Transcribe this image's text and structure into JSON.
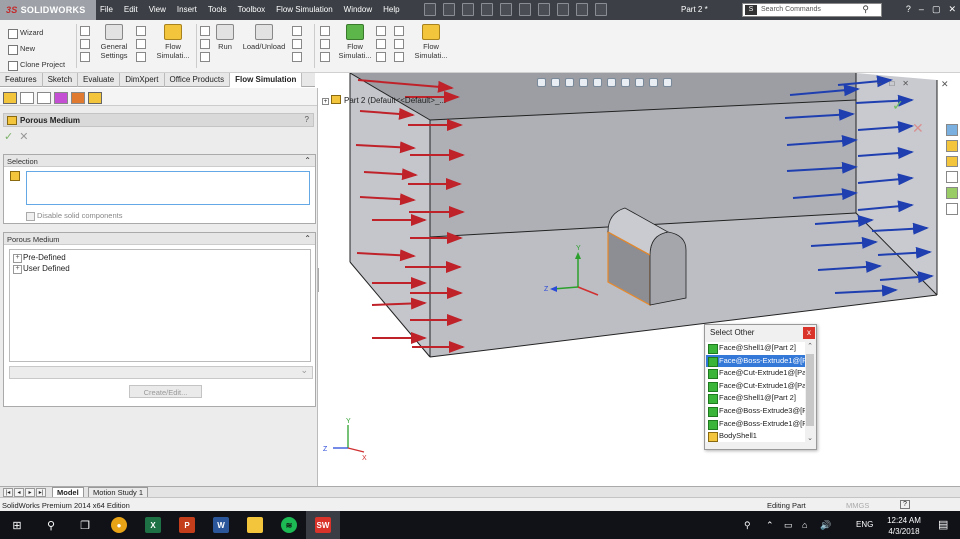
{
  "titlebar": {
    "logo": "SOLIDWORKS",
    "logo_mark": "3S",
    "menu": [
      "File",
      "Edit",
      "View",
      "Insert",
      "Tools",
      "Toolbox",
      "Flow Simulation",
      "Window",
      "Help"
    ],
    "doc_title": "Part 2 *",
    "search_placeholder": "Search Commands",
    "search_icon_label": "S",
    "window_controls": [
      "?",
      "–",
      "▢",
      "✕"
    ]
  },
  "commands": {
    "left_items": [
      "Wizard",
      "New",
      "Clone Project"
    ],
    "general_settings": "General\nSettings",
    "flow_sim_1": "Flow\nSimulati...",
    "run": "Run",
    "load_unload": "Load/Unload",
    "flow_sim_2": "Flow\nSimulati...",
    "flow_sim_3": "Flow\nSimulati..."
  },
  "tabs": [
    "Features",
    "Sketch",
    "Evaluate",
    "DimXpert",
    "Office Products",
    "Flow Simulation"
  ],
  "active_tab": "Flow Simulation",
  "property_manager": {
    "title": "Porous Medium",
    "help": "?",
    "ok": "✓",
    "cancel": "✕",
    "selection_group": {
      "label": "Selection",
      "collapse": "⌃",
      "checkbox_label": "Disable solid components"
    },
    "porous_group": {
      "label": "Porous Medium",
      "collapse": "⌃",
      "tree_items": [
        "Pre-Defined",
        "User Defined"
      ],
      "button_label": "Create/Edit..."
    }
  },
  "collapse_handle": "‹",
  "viewport": {
    "feature_tree_label": "Part 2  (Default<<Default>_...",
    "tree_expand": "+",
    "close": "✕",
    "vp_ctrls": [
      "–",
      "□",
      "✕"
    ],
    "triad_main": {
      "x": "X",
      "y": "Y",
      "z": "Z"
    },
    "triad_corner": {
      "x": "X",
      "y": "Y",
      "z": "Z"
    }
  },
  "select_other": {
    "title": "Select Other",
    "close": "x",
    "items": [
      {
        "label": "Face@Shell1@[Part 2]",
        "kind": "face",
        "selected": false
      },
      {
        "label": "Face@Boss-Extrude1@[P",
        "kind": "face",
        "selected": true
      },
      {
        "label": "Face@Cut-Extrude1@[Pa",
        "kind": "face",
        "selected": false
      },
      {
        "label": "Face@Cut-Extrude1@[Pa",
        "kind": "face",
        "selected": false
      },
      {
        "label": "Face@Shell1@[Part 2]",
        "kind": "face",
        "selected": false
      },
      {
        "label": "Face@Boss-Extrude3@[P",
        "kind": "face",
        "selected": false
      },
      {
        "label": "Face@Boss-Extrude1@[P",
        "kind": "face",
        "selected": false
      },
      {
        "label": "BodyShell1",
        "kind": "body",
        "selected": false
      }
    ],
    "scroll_up": "⌃",
    "scroll_down": "⌄"
  },
  "bottom_tabs": {
    "nav": [
      "|◂",
      "◂",
      "▸",
      "▸|"
    ],
    "items": [
      "Model",
      "Motion Study 1"
    ],
    "active": "Model"
  },
  "status": {
    "left": "SolidWorks Premium 2014 x64 Edition",
    "mode": "Editing Part",
    "units": "MMGS",
    "help": "?"
  },
  "taskbar": {
    "start": "⊞",
    "search": "⚲",
    "taskview": "❐",
    "apps": [
      {
        "name": "chrome",
        "glyph": "●",
        "color": "#e8a317",
        "active": false
      },
      {
        "name": "excel",
        "glyph": "X",
        "color": "#1e7145",
        "active": false
      },
      {
        "name": "powerpoint",
        "glyph": "P",
        "color": "#c43e1c",
        "active": false
      },
      {
        "name": "word",
        "glyph": "W",
        "color": "#2b579a",
        "active": false
      },
      {
        "name": "file-explorer",
        "glyph": "▬",
        "color": "#f3c53c",
        "active": false
      },
      {
        "name": "spotify",
        "glyph": "≋",
        "color": "#1db954",
        "active": false
      },
      {
        "name": "solidworks",
        "glyph": "SW",
        "color": "#d9332a",
        "active": true
      }
    ],
    "tray_icons": [
      "⚲",
      "⌃",
      "▭",
      "⌂",
      "🔊"
    ],
    "language": "ENG",
    "time": "12:24 AM",
    "date": "4/3/2018",
    "notifications": "▤"
  },
  "colors": {
    "inlet_arrows": "#c0222a",
    "outlet_arrows": "#1f3fb0",
    "selection_highlight": "#3478d8",
    "selected_face_edges": "#e8892a",
    "axis_x": "#d03030",
    "axis_y": "#2ca02c",
    "axis_z": "#2a4ad8"
  }
}
